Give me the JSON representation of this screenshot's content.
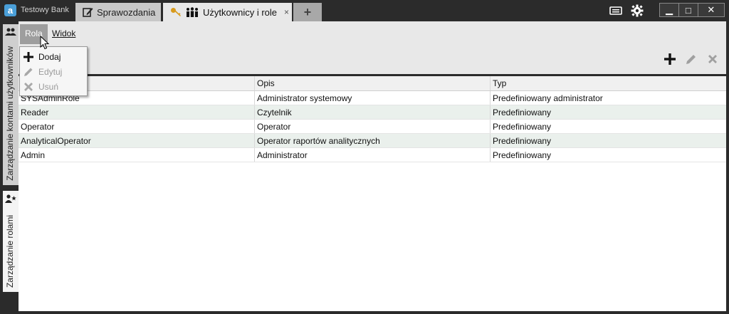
{
  "app": {
    "logo_letter": "a",
    "title": "Testowy Bank"
  },
  "tabs": [
    {
      "label": "Sprawozdania",
      "icon": "edit-icon"
    },
    {
      "label": "Użytkownicy i role",
      "icon": "key-users-icon",
      "close": "×"
    },
    {
      "label": "+",
      "icon": "plus-icon"
    }
  ],
  "window": {
    "minimize": "▁",
    "maximize": "□",
    "close": "✕"
  },
  "side_tabs": [
    {
      "label": "Zarządzanie kontami użytkowników",
      "icon": "users-icon"
    },
    {
      "label": "Zarządzanie rolami",
      "icon": "user-star-icon"
    }
  ],
  "menubar": {
    "rola": "Rola",
    "widok": "Widok"
  },
  "dropdown": {
    "items": [
      {
        "label": "Dodaj",
        "icon": "plus-icon",
        "enabled": true
      },
      {
        "label": "Edytuj",
        "icon": "pencil-icon",
        "enabled": false
      },
      {
        "label": "Usuń",
        "icon": "x-icon",
        "enabled": false
      }
    ]
  },
  "grid": {
    "columns": [
      "",
      "Opis",
      "Typ"
    ],
    "rows": [
      [
        "SYSAdminRole",
        "Administrator systemowy",
        "Predefiniowany administrator"
      ],
      [
        "Reader",
        "Czytelnik",
        "Predefiniowany"
      ],
      [
        "Operator",
        "Operator",
        "Predefiniowany"
      ],
      [
        "AnalyticalOperator",
        "Operator raportów analitycznych",
        "Predefiniowany"
      ],
      [
        "Admin",
        "Administrator",
        "Predefiniowany"
      ]
    ]
  },
  "colors": {
    "titlebar": "#2b2b2b",
    "accent": "#4a9fd8",
    "row_alt": "#eaf0ec"
  }
}
